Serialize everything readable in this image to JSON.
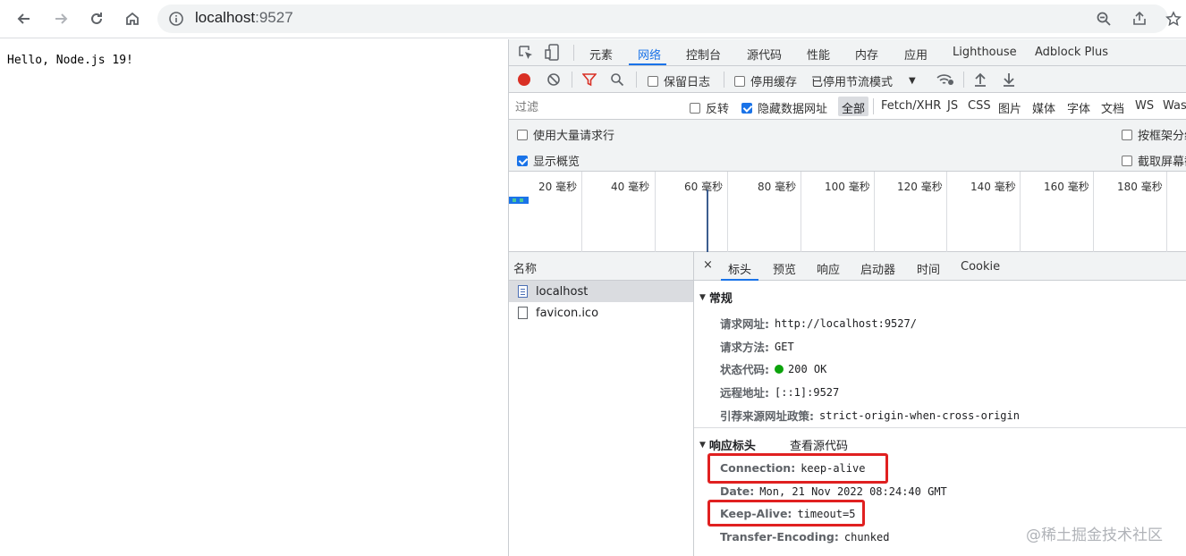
{
  "browser": {
    "url_host": "localhost",
    "url_port": ":9527",
    "icons": [
      "back-arrow-icon",
      "forward-arrow-icon",
      "reload-icon",
      "home-icon",
      "info-icon",
      "zoom-icon",
      "share-icon",
      "bookmark-star-icon"
    ]
  },
  "page": {
    "text": "Hello, Node.js 19!"
  },
  "devtools": {
    "tabs": [
      "元素",
      "网络",
      "控制台",
      "源代码",
      "性能",
      "内存",
      "应用",
      "Lighthouse",
      "Adblock Plus"
    ],
    "active_tab": "网络",
    "toolbar": {
      "preserve_log": "保留日志",
      "disable_cache": "停用缓存",
      "throttle": "已停用节流模式"
    },
    "filter": {
      "placeholder": "过滤",
      "invert": "反转",
      "hide_data_urls": "隐藏数据网址",
      "all": "全部",
      "types": [
        "Fetch/XHR",
        "JS",
        "CSS",
        "图片",
        "媒体",
        "字体",
        "文档",
        "WS",
        "Wasm"
      ]
    },
    "options": {
      "big_rows": "使用大量请求行",
      "overview": "显示概览",
      "group_by_frame": "按框架分组",
      "screenshots": "截取屏幕截图"
    },
    "timeline": {
      "labels": [
        "20 毫秒",
        "40 毫秒",
        "60 毫秒",
        "80 毫秒",
        "100 毫秒",
        "120 毫秒",
        "140 毫秒",
        "160 毫秒",
        "180 毫秒"
      ]
    },
    "names": {
      "header": "名称",
      "items": [
        "localhost",
        "favicon.ico"
      ]
    },
    "detail": {
      "close": "×",
      "tabs": [
        "标头",
        "预览",
        "响应",
        "启动器",
        "时间",
        "Cookie"
      ],
      "general": {
        "title": "常规",
        "rows": [
          {
            "k": "请求网址:",
            "v": "http://localhost:9527/"
          },
          {
            "k": "请求方法:",
            "v": "GET"
          },
          {
            "k": "状态代码:",
            "v": "200 OK"
          },
          {
            "k": "远程地址:",
            "v": "[::1]:9527"
          },
          {
            "k": "引荐来源网址政策:",
            "v": "strict-origin-when-cross-origin"
          }
        ]
      },
      "response": {
        "title": "响应标头",
        "view_source": "查看源代码",
        "rows": [
          {
            "k": "Connection:",
            "v": "keep-alive"
          },
          {
            "k": "Date:",
            "v": "Mon, 21 Nov 2022 08:24:40 GMT"
          },
          {
            "k": "Keep-Alive:",
            "v": "timeout=5"
          },
          {
            "k": "Transfer-Encoding:",
            "v": "chunked"
          }
        ]
      }
    }
  },
  "watermark": "@稀土掘金技术社区"
}
